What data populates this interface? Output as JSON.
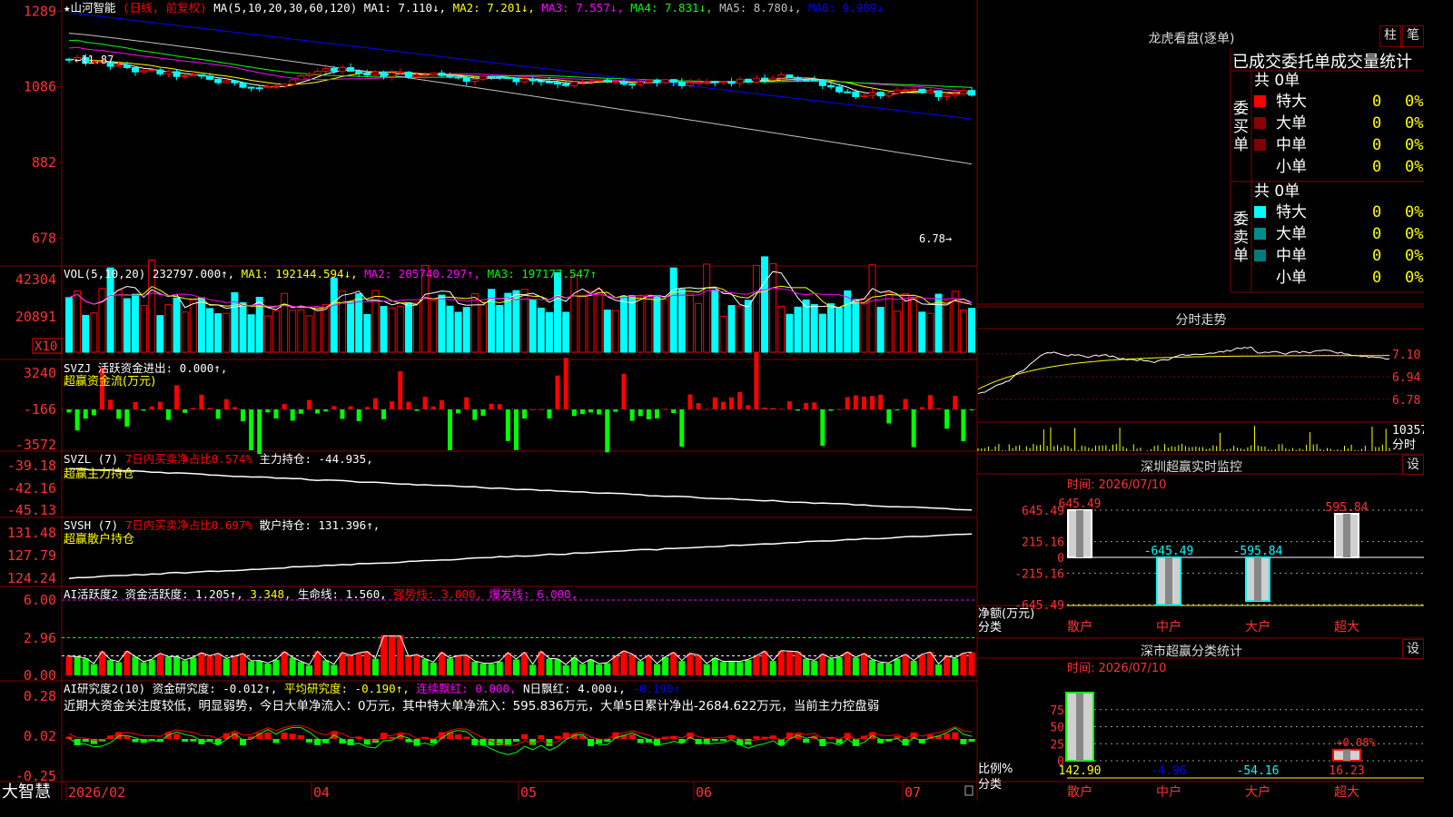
{
  "logo": "大智慧",
  "stock": {
    "name": "山河智能",
    "mode": "(日线, 前复权)"
  },
  "ma_header": [
    {
      "text": "★山河智能",
      "color": "#ffffff"
    },
    {
      "text": "(日线, 前复权)",
      "color": "#ff0000"
    },
    {
      "text": "MA(5,10,20,30,60,120)",
      "color": "#ffffff"
    },
    {
      "text": "MA1: 7.110↓,",
      "color": "#ffffff"
    },
    {
      "text": "MA2: 7.201↓,",
      "color": "#ffff00"
    },
    {
      "text": "MA3: 7.557↓,",
      "color": "#ff00ff"
    },
    {
      "text": "MA4: 7.831↓,",
      "color": "#00ff00"
    },
    {
      "text": "MA5: 8.780↓,",
      "color": "#c0c0c0"
    },
    {
      "text": "MA6: 9.989↓",
      "color": "#0000ff"
    }
  ],
  "price_axis": [
    "1289",
    "1086",
    "882",
    "678"
  ],
  "price_markers": {
    "high": "11.87",
    "low": "6.78"
  },
  "vol_header": [
    {
      "text": "VOL(5,10,20) 232797.000↑,",
      "color": "#ffffff"
    },
    {
      "text": "MA1: 192144.594↓,",
      "color": "#ffff00"
    },
    {
      "text": "MA2: 205740.297↑,",
      "color": "#ff00ff"
    },
    {
      "text": "MA3: 197177.547↑",
      "color": "#00ff00"
    }
  ],
  "vol_axis": [
    "42304",
    "20891"
  ],
  "vol_unit": "X10",
  "svzj": {
    "line1": "SVZJ 活跃资金进出: 0.000↑,",
    "line2": "超赢资金流(万元)",
    "axis": [
      "3240",
      "-166",
      "-3572"
    ]
  },
  "svzl": {
    "line1a": "SVZL (7)",
    "line1b": "7日内买卖净占比0.574%",
    "line1c": "主力持仓: -44.935,",
    "line2": "超赢主力持仓",
    "axis": [
      "-39.18",
      "-42.16",
      "-45.13"
    ]
  },
  "svsh": {
    "line1a": "SVSH (7)",
    "line1b": "7日内买卖净占比0.697%",
    "line1c": "散户持仓: 131.396↑,",
    "line2": "超赢散户持仓",
    "axis": [
      "131.48",
      "127.79",
      "124.24"
    ]
  },
  "ai_active": {
    "header": [
      {
        "text": "AI活跃度2 资金活跃度: 1.205↑,",
        "color": "#ffffff"
      },
      {
        "text": "3.348,",
        "color": "#ffff00"
      },
      {
        "text": "生命线: 1.560,",
        "color": "#ffffff"
      },
      {
        "text": "强势线: 3.000,",
        "color": "#ff0000"
      },
      {
        "text": "爆发线: 6.000,",
        "color": "#ff00ff"
      }
    ],
    "axis": [
      "6.00",
      "2.96",
      "0.00"
    ]
  },
  "ai_research": {
    "header": [
      {
        "text": "AI研究度2(10) 资金研究度: -0.012↑,",
        "color": "#ffffff"
      },
      {
        "text": "平均研究度: -0.190↑,",
        "color": "#ffff00"
      },
      {
        "text": "连续飘红: 0.000,",
        "color": "#ff00ff"
      },
      {
        "text": "N日飘红: 4.000↓,",
        "color": "#ffffff"
      },
      {
        "text": "-0.190↑",
        "color": "#0000ff"
      }
    ],
    "note": "近期大资金关注度较低，明显弱势，今日大单净流入：0万元，其中特大单净流入：595.836万元，大单5日累计净出-2684.622万元，当前主力控盘弱",
    "axis": [
      "0.28",
      "0.02",
      "-0.25"
    ]
  },
  "date_axis": [
    "2026/02",
    "04",
    "05",
    "06",
    "07"
  ],
  "right": {
    "dragon_title": "龙虎看盘(逐单)",
    "btn_zhu": "柱",
    "btn_bi": "笔",
    "order_title": "已成交委托单成交量统计",
    "buy_label": "委买单",
    "sell_label": "委卖单",
    "total_label": "共 0单",
    "rows": [
      {
        "label": "特大",
        "count": "0",
        "pct": "0%"
      },
      {
        "label": "大单",
        "count": "0",
        "pct": "0%"
      },
      {
        "label": "中单",
        "count": "0",
        "pct": "0%"
      },
      {
        "label": "小单",
        "count": "0",
        "pct": "0%"
      }
    ],
    "colors": {
      "buy": [
        "#ff0000",
        "#8b0000",
        "#800000",
        "#000000"
      ],
      "sell": [
        "#00ffff",
        "#008b8b",
        "#007b7b",
        "#000000"
      ]
    },
    "intraday_title": "分时走势",
    "intraday_axis": [
      "7.10",
      "6.94",
      "6.78"
    ],
    "intraday_vol_label": "10357",
    "intraday_vol_unit": "分时",
    "sz_monitor": {
      "title": "深圳超赢实时监控",
      "btn": "设",
      "time": "时间: 2026/07/10",
      "axis": [
        "645.49",
        "215.16",
        "0",
        "-215.16",
        "-645.49"
      ],
      "unit1": "净额(万元)",
      "unit2": "分类",
      "categories": [
        "散户",
        "中户",
        "大户",
        "超大"
      ],
      "values": [
        645.49,
        -645.49,
        -595.84,
        595.84
      ],
      "labels": [
        "645.49",
        "-645.49",
        "-595.84",
        "595.84"
      ]
    },
    "sz_class": {
      "title": "深市超赢分类统计",
      "btn": "设",
      "time": "时间: 2026/07/10",
      "axis": [
        "75",
        "50",
        "25",
        "0"
      ],
      "unit1": "比例%",
      "unit2": "分类",
      "categories": [
        "散户",
        "中户",
        "大户",
        "超大"
      ],
      "values": [
        142.9,
        -4.96,
        -54.16,
        16.23
      ],
      "labels": [
        "142.90",
        "-4.96",
        "-54.16",
        "16.23"
      ],
      "extra_label": "+0.08%"
    }
  },
  "colors": {
    "up": "#ff0000",
    "down": "#00ffff",
    "frame": "#800000",
    "axis_text": "#ff3030"
  },
  "chart_data": [
    {
      "type": "candlestick",
      "y_tick_labels": [
        "1289",
        "1086",
        "882",
        "678"
      ],
      "annotations": [
        "11.87",
        "6.78"
      ],
      "series": [
        {
          "name": "MA1",
          "last": 7.11
        },
        {
          "name": "MA2",
          "last": 7.201
        },
        {
          "name": "MA3",
          "last": 7.557
        },
        {
          "name": "MA4",
          "last": 7.831
        },
        {
          "name": "MA5",
          "last": 8.78
        },
        {
          "name": "MA6",
          "last": 9.989
        }
      ],
      "x_tick_labels": [
        "2026/02",
        "04",
        "05",
        "06",
        "07"
      ]
    },
    {
      "type": "bar",
      "y_tick_labels": [
        "42304",
        "20891"
      ],
      "series": [
        {
          "name": "VOL",
          "last": 232797.0
        },
        {
          "name": "MA1",
          "last": 192144.594
        },
        {
          "name": "MA2",
          "last": 205740.297
        },
        {
          "name": "MA3",
          "last": 197177.547
        }
      ]
    },
    {
      "type": "bar",
      "categories": [
        "散户",
        "中户",
        "大户",
        "超大"
      ],
      "values": [
        645.49,
        -645.49,
        -595.84,
        595.84
      ],
      "ylim": [
        -645.49,
        645.49
      ]
    },
    {
      "type": "bar",
      "categories": [
        "散户",
        "中户",
        "大户",
        "超大"
      ],
      "values": [
        142.9,
        -4.96,
        -54.16,
        16.23
      ]
    }
  ]
}
